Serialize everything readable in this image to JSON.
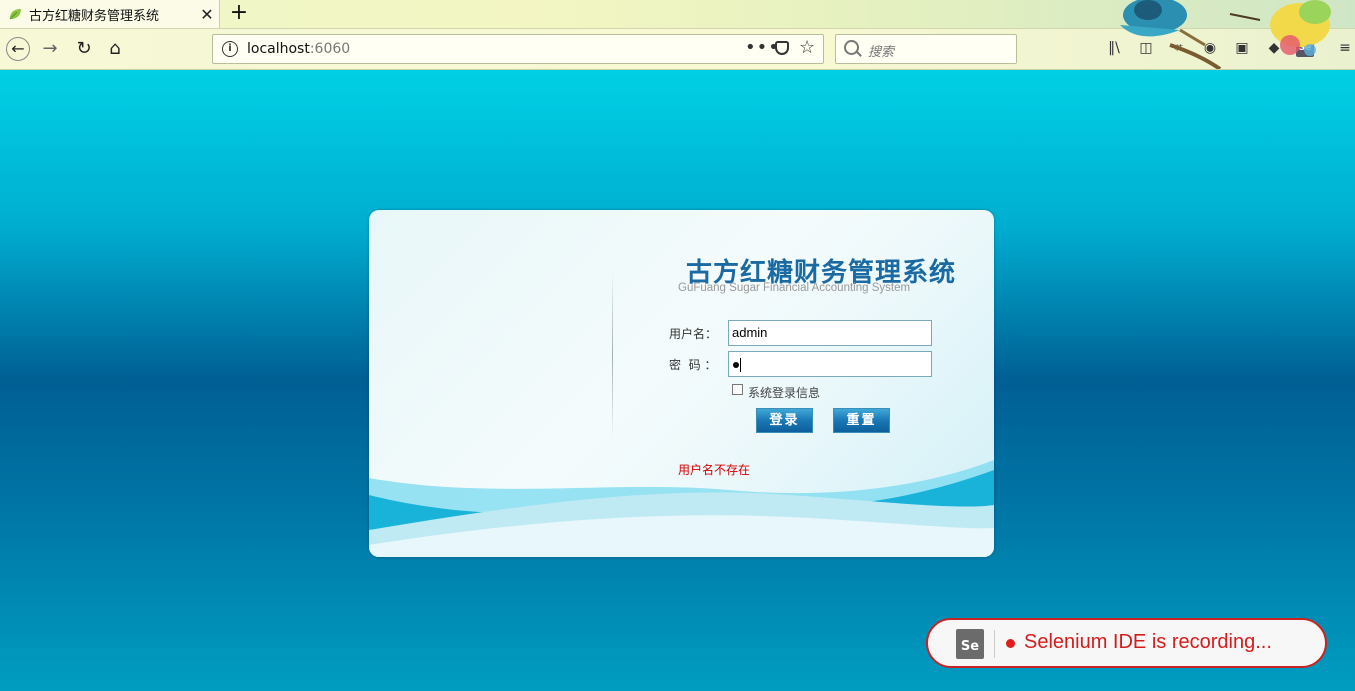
{
  "browser": {
    "tab_title": "古方红糖财务管理系统",
    "tab_close": "✕",
    "new_tab": "+",
    "url_host": "localhost",
    "url_port": ":6060",
    "search_placeholder": "搜索",
    "url_actions": "•••",
    "icons": [
      "back-icon",
      "forward-icon",
      "reload-icon",
      "home-icon",
      "info-icon",
      "page-actions-icon",
      "pocket-icon",
      "bookmark-star-icon",
      "search-icon",
      "library-icon",
      "sidebar-icon",
      "screenshot-icon",
      "chat-icon",
      "extension-icon",
      "extension-icon-2",
      "selenium-ide-icon",
      "menu-icon"
    ]
  },
  "login": {
    "system_title": "古方红糖财务管理系统",
    "system_subtitle": "GuFuang Sugar Financial Accounting System",
    "username_label": "用户名：",
    "username_value": "admin",
    "password_label": "密  码 ：",
    "remember_label": "系统登录信息",
    "remember_checked": false,
    "login_button": "登录",
    "reset_button": "重置",
    "error_message": "用户名不存在"
  },
  "selenium": {
    "logo_text": "Se",
    "recording_text": "Selenium IDE is recording..."
  },
  "colors": {
    "accent": "#1a6aa3",
    "error": "#d40000",
    "recording": "#d41c1c"
  }
}
